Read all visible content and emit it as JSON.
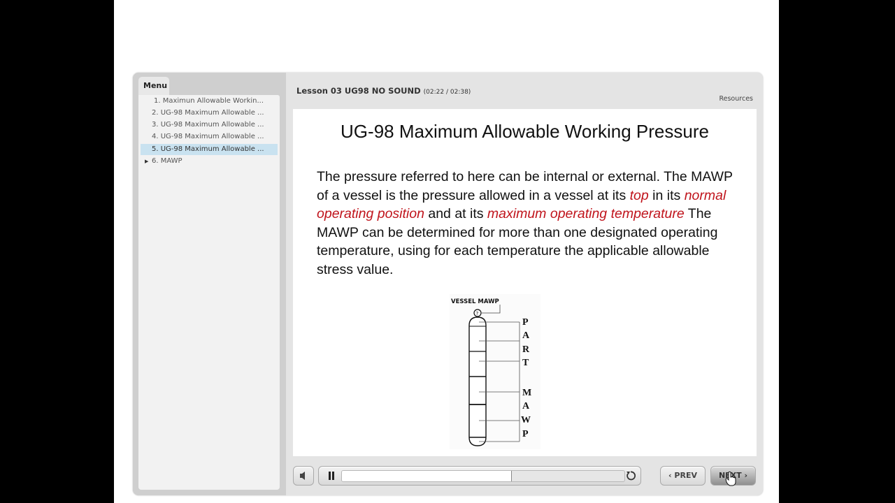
{
  "sidebar": {
    "tab_label": "Menu",
    "items": [
      {
        "label": "1.  Maximun Allowable Workin...",
        "active": false,
        "expandable": false
      },
      {
        "label": "2. UG-98 Maximum Allowable ...",
        "active": false,
        "expandable": false
      },
      {
        "label": "3. UG-98 Maximum Allowable ...",
        "active": false,
        "expandable": false
      },
      {
        "label": "4. UG-98 Maximum Allowable ...",
        "active": false,
        "expandable": false
      },
      {
        "label": "5. UG-98 Maximum Allowable ...",
        "active": true,
        "expandable": false
      },
      {
        "label": "6. MAWP",
        "active": false,
        "expandable": true
      }
    ],
    "expand_icon": "triangle-right-icon"
  },
  "header": {
    "lesson_title": "Lesson 03 UG98 NO SOUND",
    "time": "(02:22 / 02:38)",
    "resources_label": "Resources"
  },
  "slide": {
    "title": "UG-98 Maximum Allowable Working Pressure",
    "body": {
      "p1": "The pressure referred to here can be internal or external. The MAWP of a vessel is the pressure allowed in a vessel at its ",
      "em1": "top",
      "p2": " in its ",
      "em2": "normal operating position",
      "p3": " and at its ",
      "em3": "maximum operating temperature",
      "p4": "  The MAWP can be determined for more than one designated operating temperature, using for each temperature the applicable allowable stress value."
    },
    "emphasis_color": "#c0141c",
    "diagram": {
      "label": "VESSEL MAWP",
      "gauge_symbol": "?",
      "side_letters_1": [
        "P",
        "A",
        "R",
        "T"
      ],
      "side_letters_2": [
        "M",
        "A",
        "W",
        "P"
      ]
    }
  },
  "controls": {
    "volume_icon": "speaker-icon",
    "pause_icon": "pause-icon",
    "replay_icon": "replay-icon",
    "progress_fraction": 0.6,
    "prev_label": "PREV",
    "next_label": "NEXT",
    "prev_icon": "‹",
    "next_icon": "›"
  }
}
